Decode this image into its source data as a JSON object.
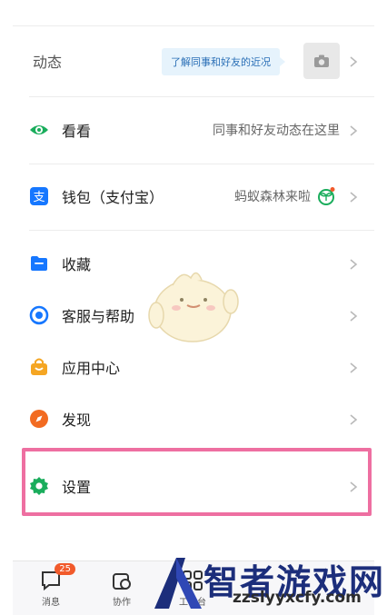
{
  "dynamics": {
    "label": "动态",
    "hint": "了解同事和好友的近况"
  },
  "kanKan": {
    "label": "看看",
    "detail": "同事和好友动态在这里"
  },
  "wallet": {
    "label": "钱包（支付宝）",
    "detail": "蚂蚁森林来啦"
  },
  "menu": [
    {
      "label": "收藏",
      "icon": "folder-icon"
    },
    {
      "label": "客服与帮助",
      "icon": "headset-icon"
    },
    {
      "label": "应用中心",
      "icon": "bag-icon"
    },
    {
      "label": "发现",
      "icon": "compass-icon"
    }
  ],
  "settings": {
    "label": "设置",
    "icon": "gear-icon"
  },
  "tabbar": {
    "messages": {
      "label": "消息",
      "badge": "25"
    },
    "collab": {
      "label": "协作"
    },
    "workbench": {
      "label": "工作台"
    }
  },
  "watermark": {
    "name": "智者游戏网",
    "url": "zzslyyxcfy.com"
  },
  "colors": {
    "accent_green": "#1aad5c",
    "blue": "#1677ff",
    "highlight": "#ee6fa1",
    "badge": "#f15a2b"
  }
}
